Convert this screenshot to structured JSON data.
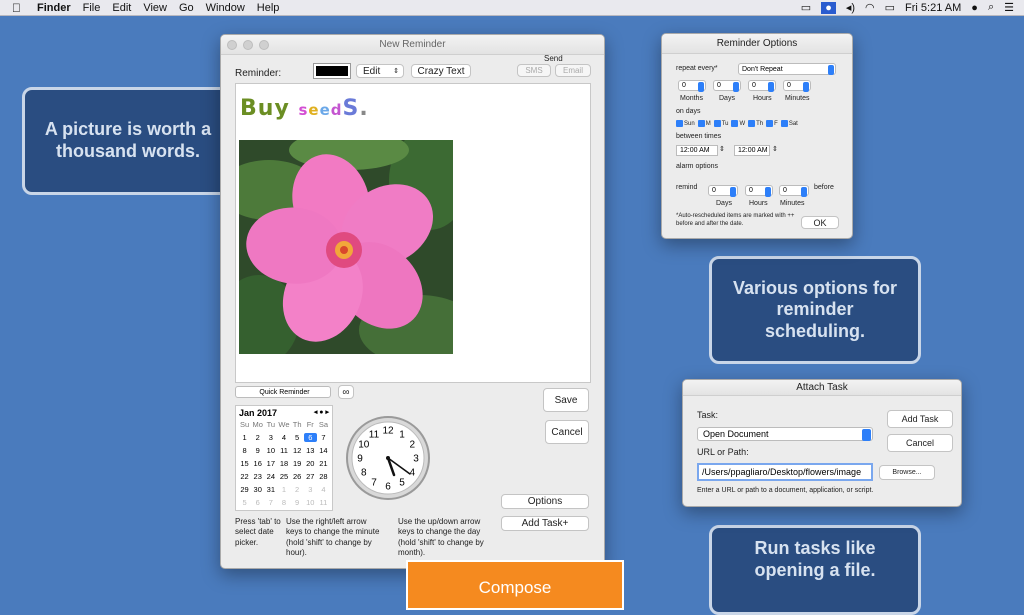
{
  "menubar": {
    "app": "Finder",
    "items": [
      "File",
      "Edit",
      "View",
      "Go",
      "Window",
      "Help"
    ],
    "clock": "Fri 5:21 AM"
  },
  "callouts": {
    "picture": "A picture is worth a thousand words.",
    "options": "Various options for reminder scheduling.",
    "tasks": "Run tasks like opening a file."
  },
  "reminder_window": {
    "title": "New Reminder",
    "reminder_label": "Reminder:",
    "edit_label": "Edit",
    "crazy_text_label": "Crazy Text",
    "send_label": "Send",
    "sms_label": "SMS",
    "email_label": "Email",
    "buy_text": [
      "B",
      "u",
      "y",
      " ",
      "s",
      "e",
      "e",
      "d",
      "S",
      "."
    ],
    "buy_colors": [
      "#6b8e23",
      "#6b8e23",
      "#6b8e23",
      "#000",
      "#d34fd3",
      "#e0b020",
      "#6ba8e8",
      "#c455d0",
      "#6a7ad8",
      "#888"
    ],
    "quick_reminder": "Quick Reminder",
    "infinity": "∞",
    "save_label": "Save",
    "cancel_label": "Cancel",
    "options_label": "Options",
    "add_task_label": "Add Task+",
    "hint1": "Press 'tab' to select date picker.",
    "hint2": "Use the right/left arrow keys to change the minute (hold 'shift' to change by hour).",
    "hint3": "Use the up/down arrow keys to change the day (hold 'shift' to change by month).",
    "calendar": {
      "month": "Jan 2017",
      "dow": [
        "Su",
        "Mo",
        "Tu",
        "We",
        "Th",
        "Fr",
        "Sa"
      ],
      "days": [
        "1",
        "2",
        "3",
        "4",
        "5",
        "6",
        "7",
        "8",
        "9",
        "10",
        "11",
        "12",
        "13",
        "14",
        "15",
        "16",
        "17",
        "18",
        "19",
        "20",
        "21",
        "22",
        "23",
        "24",
        "25",
        "26",
        "27",
        "28",
        "29",
        "30",
        "31",
        "1",
        "2",
        "3",
        "4",
        "5",
        "6",
        "7",
        "8",
        "9",
        "10",
        "11"
      ],
      "selected": "6"
    },
    "clock_numbers": [
      "12",
      "1",
      "2",
      "3",
      "4",
      "5",
      "6",
      "7",
      "8",
      "9",
      "10",
      "11"
    ],
    "clock_time": {
      "hour": 5,
      "minute": 21
    }
  },
  "options_window": {
    "title": "Reminder Options",
    "repeat_label": "repeat every*",
    "repeat_value": "Don't Repeat",
    "zero": "0",
    "months": "Months",
    "days": "Days",
    "hours": "Hours",
    "minutes": "Minutes",
    "on_days": "on days",
    "day_names": [
      "Sun",
      "M",
      "Tu",
      "W",
      "Th",
      "F",
      "Sat"
    ],
    "between_times": "between times",
    "time_from": "12:00 AM",
    "time_to": "12:00 AM",
    "alarm_options": "alarm options",
    "remind": "remind",
    "before": "before",
    "note": "*Auto-rescheduled items are marked with ++ before and after the date.",
    "ok": "OK"
  },
  "attach_window": {
    "title": "Attach Task",
    "task_label": "Task:",
    "task_value": "Open Document",
    "add_task": "Add Task",
    "cancel": "Cancel",
    "url_label": "URL or Path:",
    "url_value": "/Users/ppagliaro/Desktop/flowers/image",
    "browse": "Browse...",
    "hint": "Enter a URL or path to a document, application, or script."
  },
  "compose_label": "Compose"
}
